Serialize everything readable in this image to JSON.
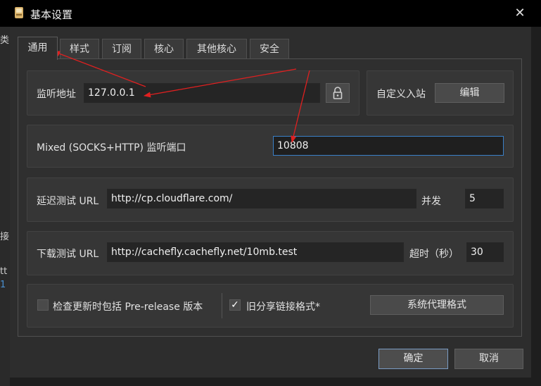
{
  "window": {
    "title": "基本设置",
    "close_symbol": "✕"
  },
  "background_fragments": [
    "类",
    "接",
    "tt",
    "1"
  ],
  "tabs": [
    {
      "label": "通用",
      "active": true
    },
    {
      "label": "样式"
    },
    {
      "label": "订阅"
    },
    {
      "label": "核心"
    },
    {
      "label": "其他核心"
    },
    {
      "label": "安全"
    }
  ],
  "listen": {
    "label": "监听地址",
    "value": "127.0.0.1"
  },
  "custom_inbound": {
    "label": "自定义入站",
    "button": "编辑"
  },
  "mixed_port": {
    "label": "Mixed (SOCKS+HTTP) 监听端口",
    "value": "10808"
  },
  "latency_test": {
    "label": "延迟测试 URL",
    "value": "http://cp.cloudflare.com/",
    "concurrency_label": "并发",
    "concurrency_value": "5"
  },
  "download_test": {
    "label": "下载测试 URL",
    "value": "http://cachefly.cachefly.net/10mb.test",
    "timeout_label": "超时（秒）",
    "timeout_value": "30"
  },
  "options": {
    "prerelease_label": "检查更新时包括 Pre-release 版本",
    "prerelease_checked": false,
    "legacy_share_label": "旧分享链接格式*",
    "legacy_share_checked": true,
    "check_mark": "✓",
    "proxy_format_button": "系统代理格式"
  },
  "footer": {
    "ok": "确定",
    "cancel": "取消"
  },
  "colors": {
    "annotation_arrow": "#e02020",
    "focus_border": "#3a80c8"
  }
}
